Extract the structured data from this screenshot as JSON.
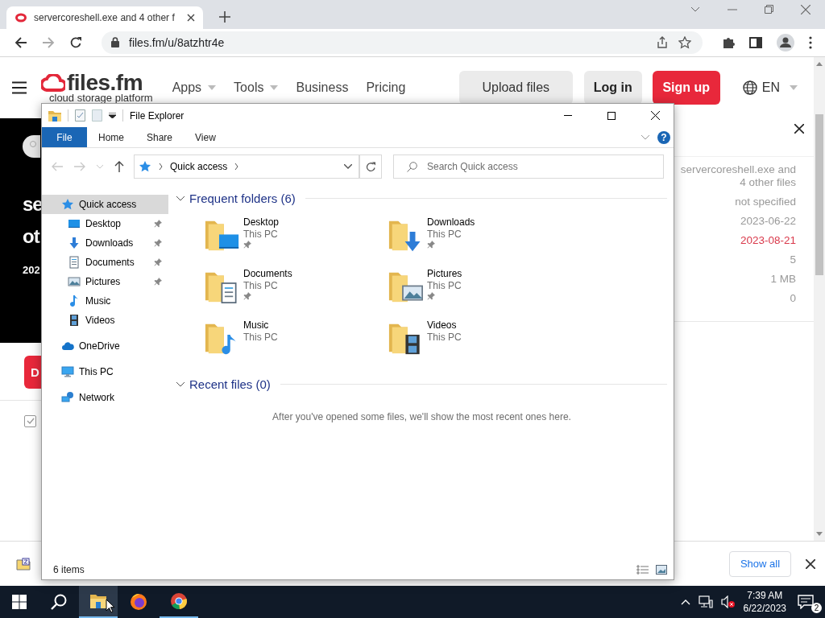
{
  "browser": {
    "tab": {
      "title": "servercoreshell.exe and 4 other f"
    },
    "url": "files.fm/u/8atzhtr4e"
  },
  "site": {
    "logo": "files.fm",
    "tagline": "cloud storage platform",
    "nav": [
      {
        "label": "Apps",
        "dropdown": true
      },
      {
        "label": "Tools",
        "dropdown": true
      },
      {
        "label": "Business",
        "dropdown": false
      },
      {
        "label": "Pricing",
        "dropdown": false
      }
    ],
    "upload": "Upload files",
    "login": "Log in",
    "signup": "Sign up",
    "language": "EN"
  },
  "hero": {
    "title_lines": [
      "se",
      "ot"
    ],
    "date": "202",
    "button": "D",
    "select_all": {
      "checked": true
    }
  },
  "details": [
    {
      "text": "servercoreshell.exe and 4 other files",
      "highlight": false
    },
    {
      "text": "not specified",
      "highlight": false
    },
    {
      "text": "2023-06-22",
      "highlight": false
    },
    {
      "text": "2023-08-21",
      "highlight": true
    },
    {
      "text": "5",
      "highlight": false
    },
    {
      "text": "1 MB",
      "highlight": false
    },
    {
      "text": "0",
      "highlight": false
    }
  ],
  "download_bar": {
    "show_all": "Show all"
  },
  "explorer": {
    "title": "File Explorer",
    "ribbon_tabs": [
      {
        "label": "File",
        "selected": true
      },
      {
        "label": "Home",
        "selected": false
      },
      {
        "label": "Share",
        "selected": false
      },
      {
        "label": "View",
        "selected": false
      }
    ],
    "help": "?",
    "address": {
      "location": "Quick access"
    },
    "search": {
      "placeholder": "Search Quick access"
    },
    "nav": [
      {
        "label": "Quick access",
        "kind": "quick",
        "selected": true,
        "children": [
          {
            "label": "Desktop",
            "kind": "desktop",
            "pinned": true,
            "selected": false
          },
          {
            "label": "Downloads",
            "kind": "downloads",
            "pinned": true,
            "selected": false
          },
          {
            "label": "Documents",
            "kind": "documents",
            "pinned": true,
            "selected": false
          },
          {
            "label": "Pictures",
            "kind": "pictures",
            "pinned": true,
            "selected": false
          },
          {
            "label": "Music",
            "kind": "music",
            "pinned": false,
            "selected": false
          },
          {
            "label": "Videos",
            "kind": "videos",
            "pinned": false,
            "selected": false
          }
        ]
      },
      {
        "label": "OneDrive",
        "kind": "onedrive",
        "selected": false
      },
      {
        "label": "This PC",
        "kind": "thispc",
        "selected": false
      },
      {
        "label": "Network",
        "kind": "network",
        "selected": false
      }
    ],
    "sections": [
      {
        "title": "Frequent folders (6)",
        "expanded": true,
        "folders": [
          {
            "name": "Desktop",
            "location": "This PC",
            "kind": "desktop",
            "pinned": true
          },
          {
            "name": "Downloads",
            "location": "This PC",
            "kind": "downloads",
            "pinned": true
          },
          {
            "name": "Documents",
            "location": "This PC",
            "kind": "documents",
            "pinned": true
          },
          {
            "name": "Pictures",
            "location": "This PC",
            "kind": "pictures",
            "pinned": true
          },
          {
            "name": "Music",
            "location": "This PC",
            "kind": "music",
            "pinned": false
          },
          {
            "name": "Videos",
            "location": "This PC",
            "kind": "videos",
            "pinned": false
          }
        ]
      },
      {
        "title": "Recent files (0)",
        "expanded": true,
        "empty_message": "After you've opened some files, we'll show the most recent ones here."
      }
    ],
    "status": "6 items"
  },
  "taskbar": {
    "apps": [
      {
        "kind": "explorer",
        "selected": true,
        "running": true
      },
      {
        "kind": "firefox",
        "selected": false,
        "running": false
      },
      {
        "kind": "chrome",
        "selected": false,
        "running": true
      }
    ],
    "time": "7:39 AM",
    "date": "6/22/2023",
    "notifications": "2"
  }
}
